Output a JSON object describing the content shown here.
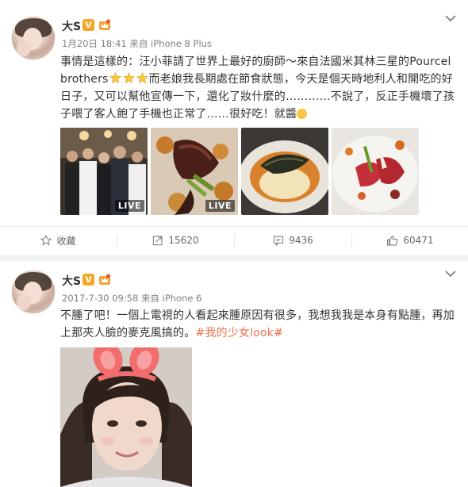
{
  "posts": [
    {
      "author": "大S",
      "verified_badge": "V",
      "meta": "1月20日 18:41 来自 iPhone 8 Plus",
      "text_part1": "事情是這樣的：汪小菲請了世界上最好的廚師～來自法國米其林三星的Pourcel brothers",
      "text_part2": "而老娘我長期處在節食狀態，今天是個天時地利人和開吃的好日子，又可以幫他宣傳一下，還化了妝什麼的…………不說了，反正手機壞了孩子喂了客人飽了手機也正常了……很好吃！就醬",
      "photos": [
        {
          "icon": "group-photo-image",
          "badge": "LIVE"
        },
        {
          "icon": "steak-dish-image",
          "badge": "LIVE"
        },
        {
          "icon": "soup-dish-image",
          "badge": ""
        },
        {
          "icon": "lobster-dish-image",
          "badge": ""
        }
      ],
      "actions": {
        "favorite_label": "收藏",
        "repost_count": "15620",
        "comment_count": "9436",
        "like_count": "60471"
      }
    },
    {
      "author": "大S",
      "verified_badge": "V",
      "meta": "2017-7-30 09:58 来自 iPhone 6",
      "text": "不腫了吧！一個上電視的人看起來腫原因有很多，我想我我是本身有點腫，再加上那夾人臉的麥克風搞的。",
      "hashtag": "#我的少女look#",
      "photo_icon": "selfie-bunny-ears-image"
    }
  ],
  "colors": {
    "accent_orange": "#eb7350",
    "badge_orange": "#f5a623",
    "separator": "#f2f2f5"
  }
}
